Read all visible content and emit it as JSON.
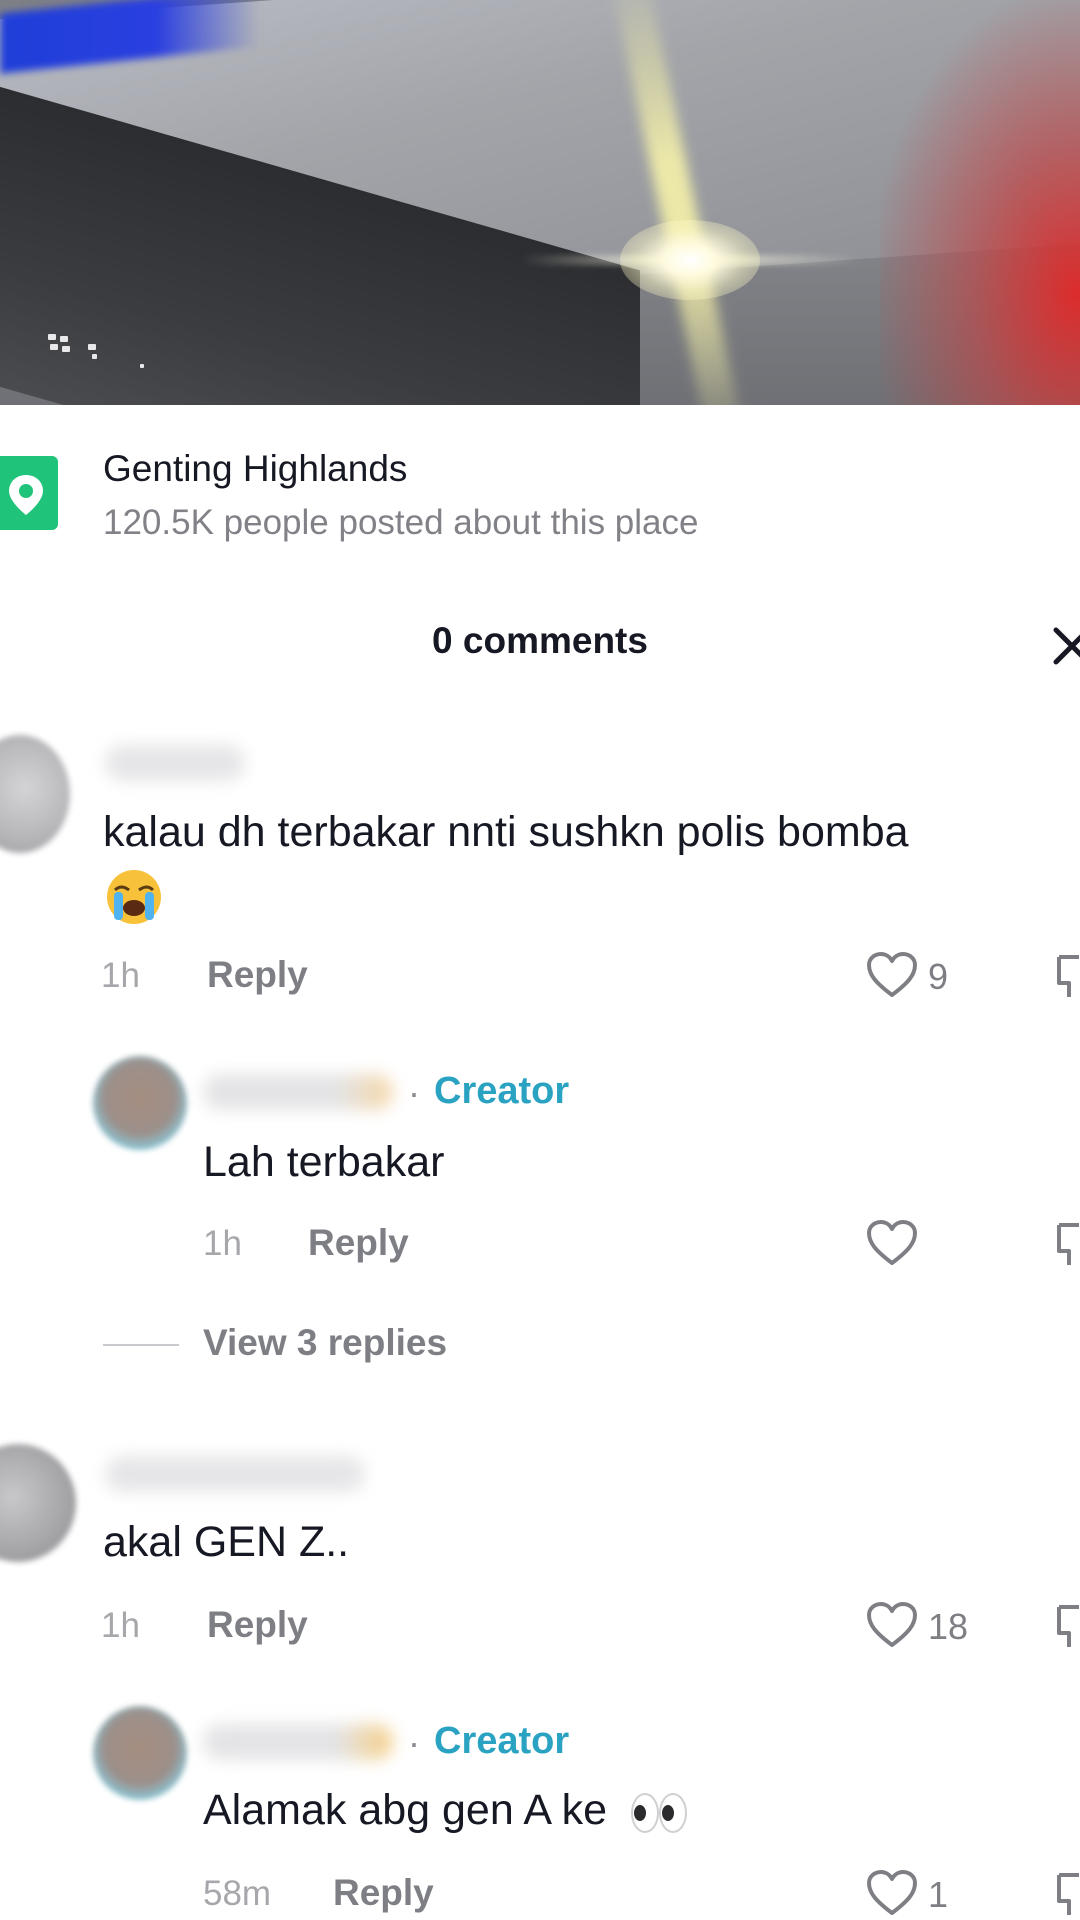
{
  "location": {
    "title": "Genting Highlands",
    "subtitle": "120.5K people posted about this place",
    "icon": "location-pin-icon",
    "accent_color": "#20c37a"
  },
  "comments_panel": {
    "title": "0 comments",
    "close_icon": "close-icon"
  },
  "comments": [
    {
      "text": "kalau dh terbakar nnti sushkn polis bomba",
      "emoji": "loudly-crying-face",
      "time": "1h",
      "reply_label": "Reply",
      "likes": "9",
      "replies": [
        {
          "creator_label": "Creator",
          "separator": "·",
          "text": "Lah terbakar",
          "time": "1h",
          "reply_label": "Reply",
          "likes": ""
        }
      ],
      "view_replies_label": "View 3 replies"
    },
    {
      "text": "akal GEN Z..",
      "time": "1h",
      "reply_label": "Reply",
      "likes": "18",
      "replies": [
        {
          "creator_label": "Creator",
          "separator": "·",
          "text": "Alamak abg gen A ke",
          "emoji": "eyes",
          "time": "58m",
          "reply_label": "Reply",
          "likes": "1"
        }
      ]
    }
  ],
  "colors": {
    "creator": "#2aa3c2",
    "muted_text": "#7e7f84",
    "primary_text": "#161823"
  }
}
